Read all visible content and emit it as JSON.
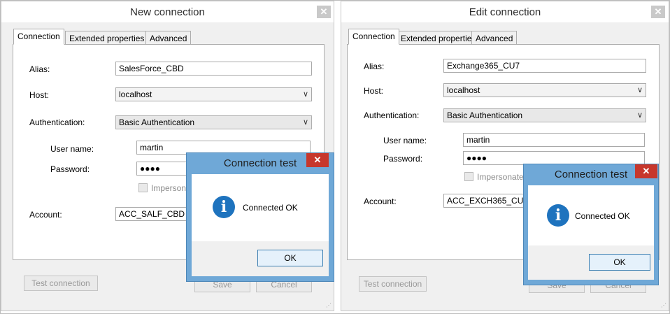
{
  "left_window": {
    "title": "New connection",
    "close": "✕",
    "tabs": [
      "Connection",
      "Extended properties",
      "Advanced"
    ],
    "labels": {
      "alias": "Alias:",
      "host": "Host:",
      "authentication": "Authentication:",
      "user_name": "User name:",
      "password": "Password:",
      "impersonate": "Impersonate",
      "account": "Account:"
    },
    "values": {
      "alias": "SalesForce_CBD",
      "host": "localhost",
      "authentication": "Basic Authentication",
      "user_name": "martin",
      "password": "●●●●",
      "account": "ACC_SALF_CBD"
    },
    "buttons": {
      "test_connection": "Test connection",
      "save": "Save",
      "cancel": "Cancel"
    }
  },
  "right_window": {
    "title": "Edit connection",
    "close": "✕",
    "tabs": [
      "Connection",
      "Extended properties",
      "Advanced"
    ],
    "labels": {
      "alias": "Alias:",
      "host": "Host:",
      "authentication": "Authentication:",
      "user_name": "User name:",
      "password": "Password:",
      "impersonate": "Impersonate a",
      "account": "Account:"
    },
    "values": {
      "alias": "Exchange365_CU7",
      "host": "localhost",
      "authentication": "Basic Authentication",
      "user_name": "martin",
      "password": "●●●●",
      "account": "ACC_EXCH365_CU7"
    },
    "buttons": {
      "test_connection": "Test connection",
      "save": "Save",
      "cancel": "Cancel"
    }
  },
  "dialog_left": {
    "title": "Connection test",
    "close": "✕",
    "icon": "i",
    "message": "Connected OK",
    "ok": "OK"
  },
  "dialog_right": {
    "title": "Connection test",
    "close": "✕",
    "icon": "i",
    "message": "Connected OK",
    "ok": "OK"
  }
}
